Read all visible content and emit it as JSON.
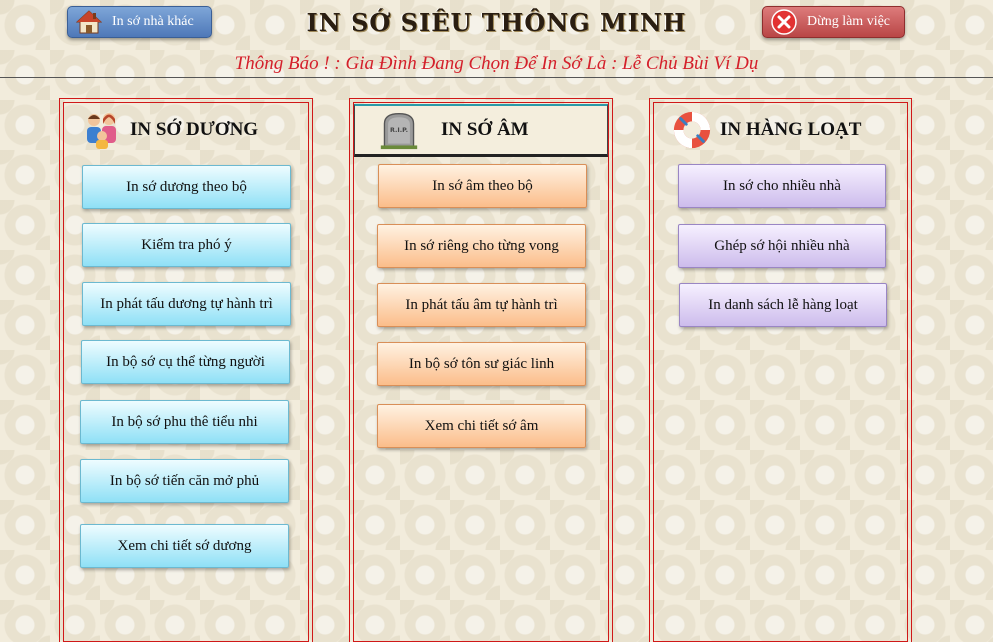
{
  "header": {
    "title": "IN SỚ SIÊU THÔNG MINH",
    "other_house_button": "In sớ nhà khác",
    "stop_button": "Dừng làm việc",
    "notice": "Thông Báo ! : Gia Đình Đang Chọn Để In Sớ Là : Lễ Chủ Bùi Ví Dụ"
  },
  "panels": {
    "duong": {
      "title": "IN SỚ DƯƠNG",
      "icon": "family-icon",
      "buttons": [
        "In sớ dương theo bộ",
        "Kiểm tra phó ý",
        "In phát tấu dương tự hành trì",
        "In bộ sớ cụ thể từng người",
        "In bộ sớ phu thê tiểu nhi",
        "In bộ sớ tiến căn mở phủ",
        "Xem chi tiết sớ dương"
      ]
    },
    "am": {
      "title": "IN SỚ ÂM",
      "icon": "tombstone-icon",
      "tomb_text": "R.I.P.",
      "buttons": [
        "In sớ âm theo bộ",
        "In sớ riêng cho từng vong",
        "In phát tấu âm tự hành trì",
        "In bộ sớ tôn sư giác linh",
        "Xem chi tiết sớ âm"
      ]
    },
    "hangloat": {
      "title": "IN HÀNG LOẠT",
      "icon": "lifebuoy-icon",
      "buttons": [
        "In sớ cho nhiều nhà",
        "Ghép sớ hội nhiều nhà",
        "In danh sách lễ hàng loạt"
      ]
    }
  },
  "colors": {
    "notice": "#d4202b",
    "panel_border": "#d01818",
    "duong_button": "#8fe0f6",
    "am_button": "#fbbd8a",
    "hangloat_button": "#cdbcec"
  }
}
